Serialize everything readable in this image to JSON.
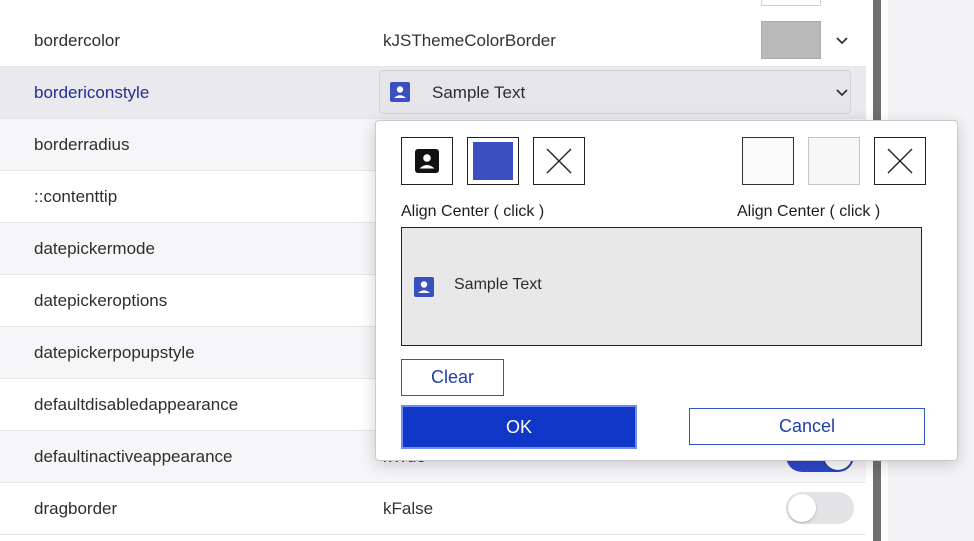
{
  "rows": [
    {
      "prop": "bordercolor",
      "value": "kJSThemeColorBorder"
    },
    {
      "prop": "bordericonstyle",
      "value": "Sample Text"
    },
    {
      "prop": "borderradius",
      "value": ""
    },
    {
      "prop": "::contenttip",
      "value": ""
    },
    {
      "prop": "datepickermode",
      "value": ""
    },
    {
      "prop": "datepickeroptions",
      "value": ""
    },
    {
      "prop": "datepickerpopupstyle",
      "value": ""
    },
    {
      "prop": "defaultdisabledappearance",
      "value": ""
    },
    {
      "prop": "defaultinactiveappearance",
      "value": "kTrue"
    },
    {
      "prop": "dragborder",
      "value": "kFalse"
    }
  ],
  "popover": {
    "left_align_label": "Align Center ( click )",
    "right_align_label": "Align Center ( click )",
    "preview_text": "Sample Text",
    "clear_label": "Clear",
    "ok_label": "OK",
    "cancel_label": "Cancel"
  },
  "colors": {
    "accent": "#1036c8",
    "selected_icon_bg": "#3a4fc0",
    "swatch": "#b9b9b9",
    "icon": "#3a4fc0"
  },
  "toggles": {
    "defaultinactiveappearance": true,
    "dragborder": false
  },
  "icons": {
    "contact": "contact-card-icon",
    "chevron": "chevron-down-icon",
    "clear": "x-icon"
  }
}
